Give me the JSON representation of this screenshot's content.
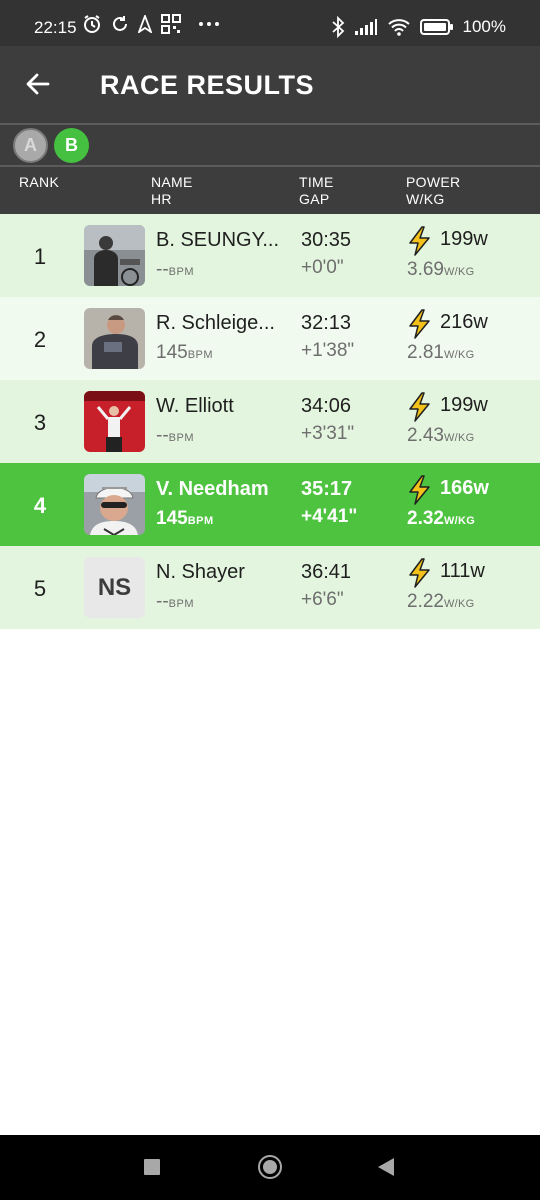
{
  "status_bar": {
    "time": "22:15",
    "battery_percent": "100%",
    "icons": [
      "alarm-icon",
      "sync-icon",
      "location-arrow-icon",
      "qr-code-icon",
      "more-dots-icon",
      "bluetooth-icon",
      "signal-icon",
      "wifi-icon",
      "battery-icon"
    ]
  },
  "app_bar": {
    "title": "RACE RESULTS",
    "back_icon": "arrow-left-icon"
  },
  "categories": [
    {
      "label": "A",
      "selected": false
    },
    {
      "label": "B",
      "selected": true
    }
  ],
  "columns": {
    "rank": "RANK",
    "name": "NAME",
    "hr": "HR",
    "time": "TIME",
    "gap": "GAP",
    "power": "POWER",
    "wkg": "W/KG"
  },
  "units": {
    "bpm": "BPM",
    "wkg": "W/KG"
  },
  "results": [
    {
      "rank": "1",
      "name": "B. SEUNGY...",
      "hr": "--",
      "time": "30:35",
      "gap": "+0'0\"",
      "power": "199w",
      "wkg": "3.69",
      "avatar": "photo"
    },
    {
      "rank": "2",
      "name": "R. Schleige...",
      "hr": "145",
      "time": "32:13",
      "gap": "+1'38\"",
      "power": "216w",
      "wkg": "2.81",
      "avatar": "photo"
    },
    {
      "rank": "3",
      "name": "W. Elliott",
      "hr": "--",
      "time": "34:06",
      "gap": "+3'31\"",
      "power": "199w",
      "wkg": "2.43",
      "avatar": "photo"
    },
    {
      "rank": "4",
      "name": "V. Needham",
      "hr": "145",
      "time": "35:17",
      "gap": "+4'41\"",
      "power": "166w",
      "wkg": "2.32",
      "avatar": "photo",
      "highlighted": true
    },
    {
      "rank": "5",
      "name": "N. Shayer",
      "hr": "--",
      "time": "36:41",
      "gap": "+6'6\"",
      "power": "111w",
      "wkg": "2.22",
      "avatar": "initials",
      "initials": "NS"
    }
  ],
  "colors": {
    "header_bg": "#3d3d3d",
    "highlight_green": "#4ec340",
    "row_light_green": "#e3f5de",
    "row_lighter_green": "#f1faef",
    "bolt_yellow": "#f2c21b"
  }
}
